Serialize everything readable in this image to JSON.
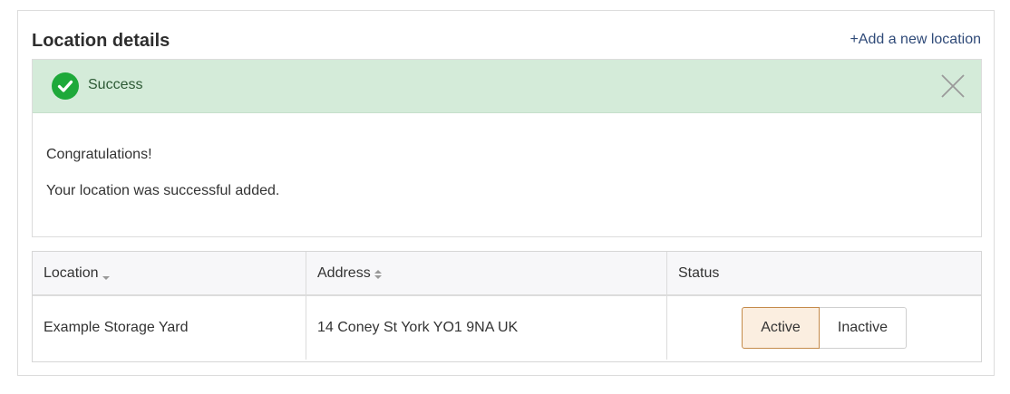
{
  "panel": {
    "title": "Location details",
    "add_link": "+Add a new location"
  },
  "alert": {
    "title": "Success",
    "messages": [
      "Congratulations!",
      "Your location was successful added."
    ],
    "icon": "check-circle-icon",
    "close_icon": "close-icon",
    "color": "#1ea93a"
  },
  "table": {
    "headers": [
      "Location",
      "Address",
      "Status"
    ],
    "rows": [
      {
        "location": "Example Storage Yard",
        "address": "14 Coney St York YO1 9NA UK",
        "status_options": [
          "Active",
          "Inactive"
        ],
        "status_selected": "Active"
      }
    ]
  }
}
